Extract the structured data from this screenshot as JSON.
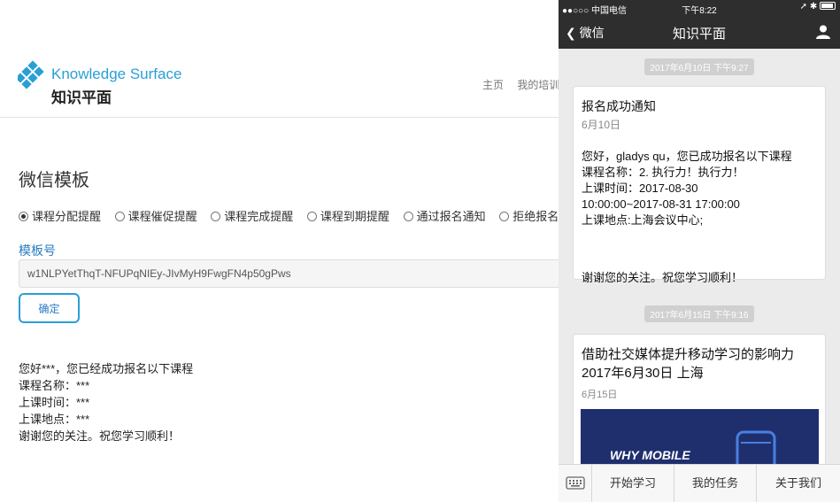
{
  "web": {
    "logo": {
      "en": "Knowledge Surface",
      "cn": "知识平面",
      "icon": "diamond-grid-logo",
      "color": "#2a9fd6"
    },
    "nav": {
      "home": "主页",
      "my_training": "我的培训"
    },
    "page_title": "微信模板",
    "template_types": [
      {
        "label": "课程分配提醒",
        "checked": true
      },
      {
        "label": "课程催促提醒",
        "checked": false
      },
      {
        "label": "课程完成提醒",
        "checked": false
      },
      {
        "label": "课程到期提醒",
        "checked": false
      },
      {
        "label": "通过报名通知",
        "checked": false
      },
      {
        "label": "拒绝报名通",
        "checked": false
      }
    ],
    "template_id": {
      "label": "模板号",
      "value": "w1NLPYetThqT-NFUPqNIEy-JIvMyH9FwgFN4p50gPws"
    },
    "confirm_label": "确定",
    "preview": [
      "您好***，您已经成功报名以下课程",
      "课程名称：***",
      "上课时间：***",
      "上课地点：***",
      "谢谢您的关注。祝您学习顺利！"
    ]
  },
  "phone": {
    "status": {
      "carrier": "●●○○○ 中国电信",
      "time": "下午8:22"
    },
    "back_label": "微信",
    "title": "知识平面",
    "messages": [
      {
        "time": "2017年6月10日 下午9:27",
        "title": "报名成功通知",
        "date": "6月10日",
        "lines": [
          "您好，gladys qu，您已成功报名以下课程",
          "课程名称：2. 执行力！执行力！",
          "上课时间：2017-08-30",
          "10:00:00~2017-08-31 17:00:00",
          "上课地点:上海会议中心;"
        ],
        "footer": "谢谢您的关注。祝您学习顺利！"
      },
      {
        "time": "2017年6月15日 下午9:16",
        "title_lines": [
          "借助社交媒体提升移动学习的影响力",
          "2017年6月30日 上海"
        ],
        "date": "6月15日",
        "image_text": "WHY MOBILE"
      }
    ],
    "tabs": [
      "开始学习",
      "我的任务",
      "关于我们"
    ]
  }
}
